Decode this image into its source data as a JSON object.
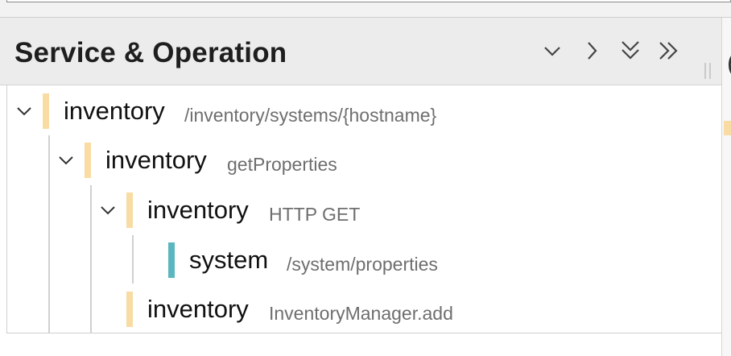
{
  "header": {
    "title": "Service & Operation",
    "buttons": [
      {
        "name": "collapse-one-level",
        "icon": "chevron-down-icon"
      },
      {
        "name": "expand-one-level",
        "icon": "chevron-right-icon"
      },
      {
        "name": "collapse-all",
        "icon": "double-chevron-down-icon"
      },
      {
        "name": "expand-all",
        "icon": "double-chevron-right-icon"
      }
    ]
  },
  "right_strip": {
    "cut_text": "("
  },
  "colors": {
    "span_bar_inventory": "#f8dca3",
    "span_bar_system": "#5bb7bf",
    "header_bg": "#ececec",
    "operation_text": "#6e6e6e"
  },
  "tree": {
    "rows": [
      {
        "service": "inventory",
        "operation": "/inventory/systems/{hostname}",
        "depth": 0,
        "expanded": true,
        "color": "#f8dca3"
      },
      {
        "service": "inventory",
        "operation": "getProperties",
        "depth": 1,
        "expanded": true,
        "color": "#f8dca3"
      },
      {
        "service": "inventory",
        "operation": "HTTP GET",
        "depth": 2,
        "expanded": true,
        "color": "#f8dca3"
      },
      {
        "service": "system",
        "operation": "/system/properties",
        "depth": 3,
        "expanded": null,
        "color": "#5bb7bf"
      },
      {
        "service": "inventory",
        "operation": "InventoryManager.add",
        "depth": 2,
        "expanded": null,
        "color": "#f8dca3"
      }
    ]
  }
}
